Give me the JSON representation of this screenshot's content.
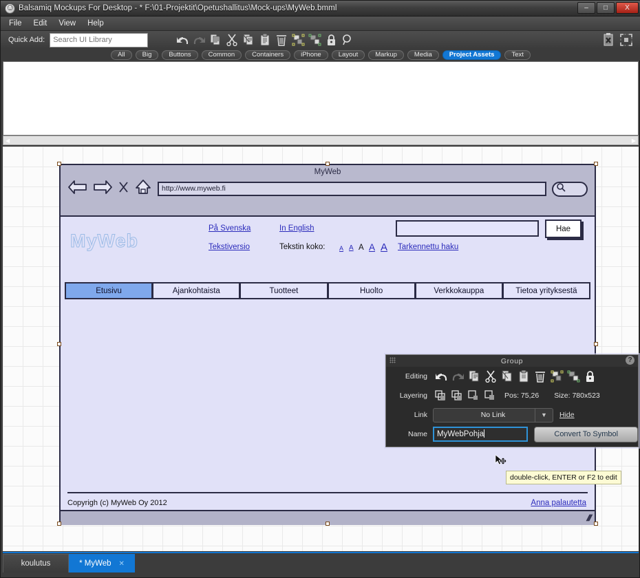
{
  "window": {
    "title": "Balsamiq Mockups For Desktop - * F:\\01-Projektit\\Opetushallitus\\Mock-ups\\MyWeb.bmml",
    "app_icon": "balsamiq-smiley-icon",
    "minimize_label": "–",
    "maximize_label": "□",
    "close_label": "X"
  },
  "menu": {
    "items": [
      "File",
      "Edit",
      "View",
      "Help"
    ]
  },
  "quick_add": {
    "label": "Quick Add:",
    "placeholder": "Search UI Library",
    "value": ""
  },
  "toolbar": {
    "icons": [
      "undo-icon",
      "redo-icon",
      "copy-icon",
      "cut-icon",
      "duplicate-icon",
      "paste-icon",
      "delete-icon",
      "group-icon",
      "ungroup-icon",
      "lock-icon",
      "zoom-icon"
    ],
    "right_icons": [
      "clear-search-icon",
      "fit-to-screen-icon"
    ]
  },
  "library_tabs": {
    "items": [
      "All",
      "Big",
      "Buttons",
      "Common",
      "Containers",
      "iPhone",
      "Layout",
      "Markup",
      "Media",
      "Project Assets",
      "Text"
    ],
    "selected": "Project Assets",
    "selected_color": "#1277d4"
  },
  "scrollbar": {
    "left_arrow": "◀",
    "right_arrow": "▶"
  },
  "mockup": {
    "browser": {
      "window_title": "MyWeb",
      "back_icon": "arrow-left-icon",
      "forward_icon": "arrow-right-icon",
      "stop_icon": "stop-x-icon",
      "home_icon": "home-icon",
      "url": "http://www.myweb.fi",
      "search_icon": "magnifier-icon"
    },
    "page": {
      "logo": "MyWeb",
      "links": {
        "swedish": "På Svenska",
        "english": "In English",
        "text_version": "Tekstiversio",
        "advanced_search": "Tarkennettu haku"
      },
      "text_size_label": "Tekstin koko:",
      "text_size_options": [
        "A",
        "A",
        "A",
        "A",
        "A"
      ],
      "text_size_selected_index": 2,
      "search": {
        "value": "",
        "button_label": "Hae"
      },
      "nav_tabs": [
        "Etusivu",
        "Ajankohtaista",
        "Tuotteet",
        "Huolto",
        "Verkkokauppa",
        "Tietoa yrityksestä"
      ],
      "nav_active": "Etusivu",
      "footer_text": "Copyrigh (c) MyWeb Oy  2012",
      "footer_link": "Anna palautetta",
      "resize_grip_icon": "resize-grip-icon"
    }
  },
  "cursor": {
    "icon": "move-cursor-icon"
  },
  "tooltip": {
    "text": "double-click, ENTER or F2 to edit"
  },
  "group_panel": {
    "title": "Group",
    "help_label": "?",
    "drag_handle_icon": "drag-dots-icon",
    "editing": {
      "label": "Editing",
      "icons": [
        "undo-icon",
        "redo-icon",
        "copy-icon",
        "cut-icon",
        "duplicate-icon",
        "paste-icon",
        "delete-icon",
        "group-icon",
        "ungroup-icon",
        "lock-icon"
      ]
    },
    "layering": {
      "label": "Layering",
      "icons": [
        "bring-to-front-icon",
        "bring-forward-icon",
        "send-backward-icon",
        "send-to-back-icon"
      ],
      "pos": "Pos: 75,26",
      "size": "Size: 780x523"
    },
    "link": {
      "label": "Link",
      "value": "No Link",
      "caret_icon": "chevron-down-icon",
      "hide_label": "Hide"
    },
    "name": {
      "label": "Name",
      "value": "MyWebPohja",
      "convert_label": "Convert To Symbol"
    }
  },
  "file_tabs": {
    "items": [
      {
        "label": "koulutus",
        "selected": false,
        "closable": false
      },
      {
        "label": "* MyWeb",
        "selected": true,
        "closable": true,
        "close_label": "✕"
      }
    ],
    "accent_color": "#1277d4"
  }
}
